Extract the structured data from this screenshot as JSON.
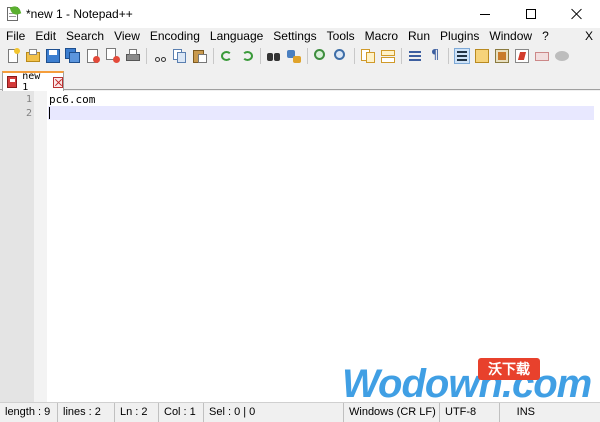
{
  "window": {
    "title": "*new 1 - Notepad++"
  },
  "menu": {
    "items": [
      "File",
      "Edit",
      "Search",
      "View",
      "Encoding",
      "Language",
      "Settings",
      "Tools",
      "Macro",
      "Run",
      "Plugins",
      "Window",
      "?"
    ],
    "close": "X"
  },
  "toolbar": {
    "icons": [
      "new-file-icon",
      "open-file-icon",
      "save-icon",
      "save-all-icon",
      "close-icon",
      "close-all-icon",
      "print-icon",
      "cut-icon",
      "copy-icon",
      "paste-icon",
      "undo-icon",
      "redo-icon",
      "find-icon",
      "replace-icon",
      "zoom-in-icon",
      "zoom-out-icon",
      "sync-vertical-icon",
      "sync-horizontal-icon",
      "word-wrap-icon",
      "show-all-chars-icon",
      "indent-guide-icon",
      "doc-map-icon",
      "function-list-icon",
      "record-macro-icon",
      "stop-record-icon",
      "play-macro-icon"
    ]
  },
  "tabs": [
    {
      "label": "new 1"
    }
  ],
  "editor": {
    "lines": [
      {
        "number": "1",
        "text": "pc6.com"
      },
      {
        "number": "2",
        "text": ""
      }
    ]
  },
  "watermark": {
    "text": "Wodown.com",
    "badge": "沃下载"
  },
  "status": {
    "length": "length : 9",
    "lines": "lines : 2",
    "ln": "Ln : 2",
    "col": "Col : 1",
    "sel": "Sel : 0 | 0",
    "eol": "Windows (CR LF)",
    "encoding": "UTF-8",
    "mode": "INS"
  },
  "colors": {
    "tab_accent": "#f59d3b",
    "current_line": "#e8e8ff",
    "watermark_blue": "#1f8fe0",
    "watermark_red": "#e8412c"
  }
}
